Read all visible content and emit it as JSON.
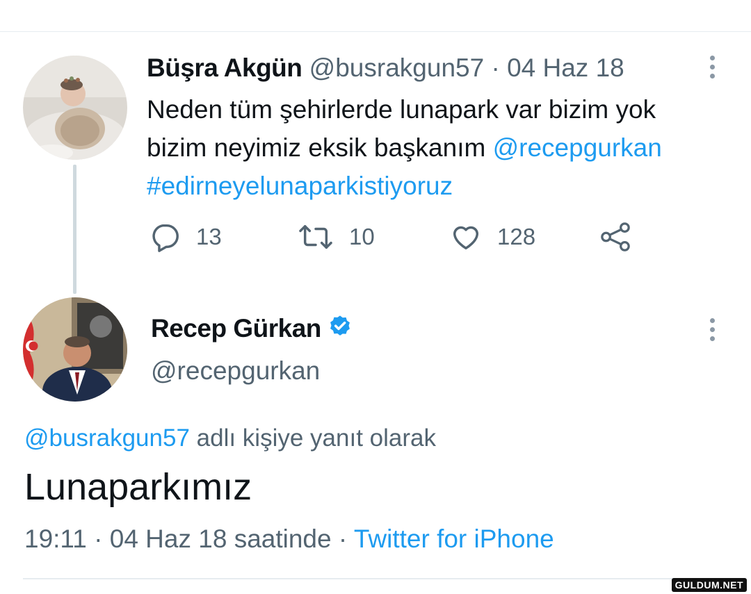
{
  "tweet": {
    "author_name": "Büşra Akgün",
    "author_handle": "@busrakgun57",
    "separator": "·",
    "date": "04 Haz 18",
    "text_line1": "Neden tüm şehirlerde lunapark var bizim yok",
    "text_line2_prefix": "bizim neyimiz eksik başkanım",
    "mention": "@recepgurkan",
    "hashtag": "#edirneyelunaparkistiyoruz",
    "replies": "13",
    "retweets": "10",
    "likes": "128",
    "icons": [
      "reply-icon",
      "retweet-icon",
      "like-icon",
      "share-icon",
      "more-icon"
    ]
  },
  "reply": {
    "author_name": "Recep Gürkan",
    "author_handle": "@recepgurkan",
    "verified": true,
    "reply_to_handle": "@busrakgun57",
    "reply_to_suffix": "adlı kişiye yanıt olarak",
    "text": "Lunaparkımız",
    "time": "19:11",
    "separator": "·",
    "date_suffix": "04 Haz 18 saatinde",
    "separator2": "·",
    "source": "Twitter for iPhone"
  },
  "colors": {
    "accent": "#1d9bf0",
    "text": "#0f1419",
    "secondary": "#536471",
    "divider": "#e6ecf0"
  },
  "watermark": "GULDUM.NET"
}
